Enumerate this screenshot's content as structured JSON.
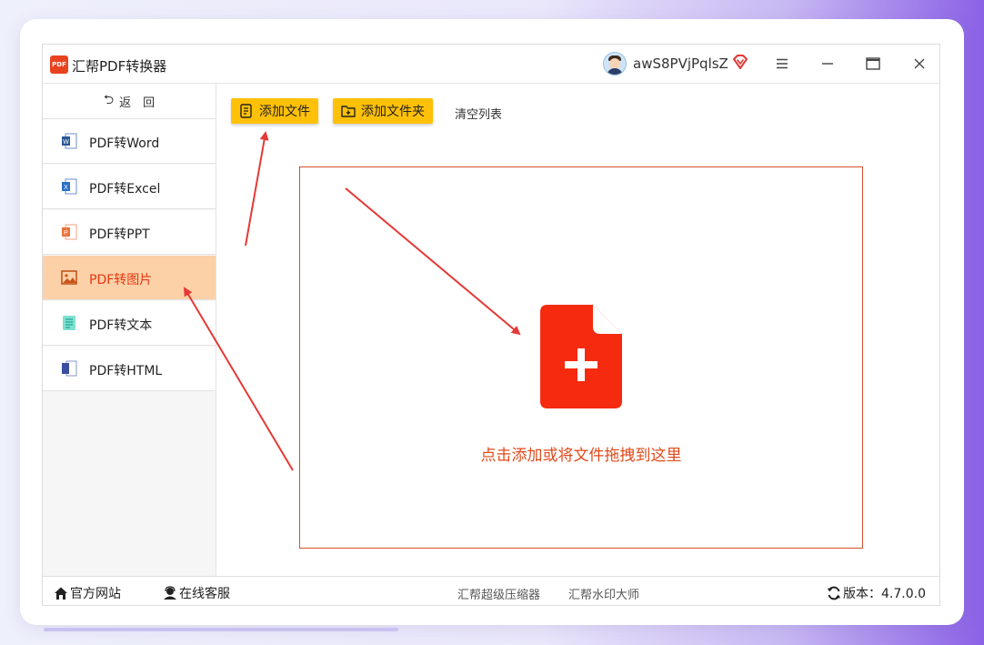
{
  "app": {
    "title": "汇帮PDF转换器",
    "logo_text": "PDF",
    "username": "awS8PVjPqlsZ"
  },
  "sidebar": {
    "back_label": "返　回",
    "items": [
      {
        "label": "PDF转Word",
        "icon": "word-icon",
        "color": "#2b5797"
      },
      {
        "label": "PDF转Excel",
        "icon": "excel-icon",
        "color": "#2b6fc7"
      },
      {
        "label": "PDF转PPT",
        "icon": "ppt-icon",
        "color": "#e8733c"
      },
      {
        "label": "PDF转图片",
        "icon": "image-icon",
        "color": "#d0601a",
        "active": true
      },
      {
        "label": "PDF转文本",
        "icon": "text-icon",
        "color": "#33c7b0"
      },
      {
        "label": "PDF转HTML",
        "icon": "html-icon",
        "color": "#3a4fa0"
      }
    ]
  },
  "toolbar": {
    "add_file_label": "添加文件",
    "add_folder_label": "添加文件夹",
    "clear_label": "清空列表"
  },
  "dropzone": {
    "hint": "点击添加或将文件拖拽到这里"
  },
  "footer": {
    "site_label": "官方网站",
    "support_label": "在线客服",
    "compressor_label": "汇帮超级压缩器",
    "watermark_label": "汇帮水印大师",
    "version_label": "版本：4.7.0.0"
  },
  "colors": {
    "accent_red": "#e8360f",
    "button_yellow": "#ffc107",
    "active_bg": "#fcd1a8",
    "annotation_arrow": "#e53935"
  }
}
